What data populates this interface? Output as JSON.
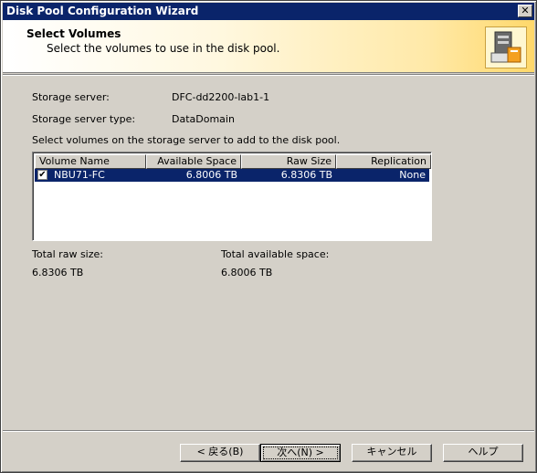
{
  "window": {
    "title": "Disk Pool Configuration Wizard",
    "close_glyph": "✕"
  },
  "header": {
    "title": "Select Volumes",
    "subtitle": "Select the volumes to use in the disk pool."
  },
  "fields": {
    "storage_server_label": "Storage server:",
    "storage_server_value": "DFC-dd2200-lab1-1",
    "storage_server_type_label": "Storage server type:",
    "storage_server_type_value": "DataDomain",
    "instruction": "Select volumes on the storage server to add to the disk pool."
  },
  "volumes": {
    "columns": [
      "Volume Name",
      "Available Space",
      "Raw Size",
      "Replication"
    ],
    "rows": [
      {
        "checked": true,
        "name": "NBU71-FC",
        "available": "6.8006 TB",
        "raw": "6.8306 TB",
        "replication": "None"
      }
    ]
  },
  "totals": {
    "raw_label": "Total raw size:",
    "raw_value": "6.8306 TB",
    "available_label": "Total available space:",
    "available_value": "6.8006 TB"
  },
  "buttons": {
    "back": "< 戻る(B)",
    "next": "次へ(N) >",
    "cancel": "キャンセル",
    "help": "ヘルプ"
  },
  "icons": {
    "header_icon": "disk-pool-icon",
    "check_glyph": "✔"
  }
}
